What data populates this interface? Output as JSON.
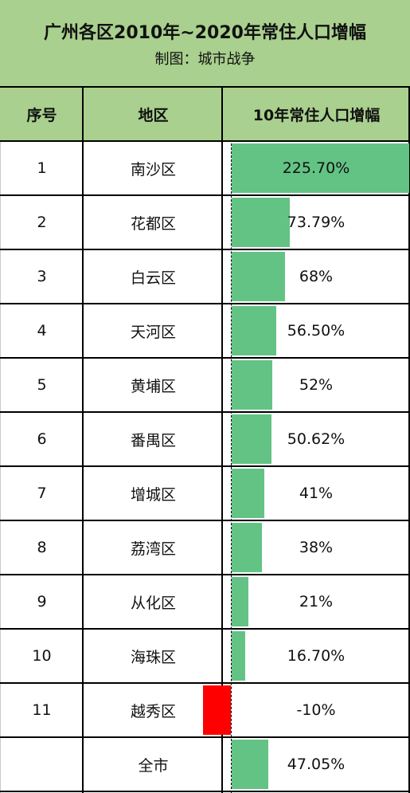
{
  "header": {
    "title": "广州各区2010年~2020年常住人口增幅",
    "subtitle": "制图：城市战争"
  },
  "columns": [
    "序号",
    "地区",
    "10年常住人口增幅"
  ],
  "colors": {
    "positive": "#63c384",
    "negative": "#ff0000",
    "header_bg": "#a9d08e"
  },
  "rows": [
    {
      "no": "1",
      "district": "南沙区",
      "label": "225.70%"
    },
    {
      "no": "2",
      "district": "花都区",
      "label": "73.79%"
    },
    {
      "no": "3",
      "district": "白云区",
      "label": "68%"
    },
    {
      "no": "4",
      "district": "天河区",
      "label": "56.50%"
    },
    {
      "no": "5",
      "district": "黄埔区",
      "label": "52%"
    },
    {
      "no": "6",
      "district": "番禺区",
      "label": "50.62%"
    },
    {
      "no": "7",
      "district": "增城区",
      "label": "41%"
    },
    {
      "no": "8",
      "district": "荔湾区",
      "label": "38%"
    },
    {
      "no": "9",
      "district": "从化区",
      "label": "21%"
    },
    {
      "no": "10",
      "district": "海珠区",
      "label": "16.70%"
    },
    {
      "no": "11",
      "district": "越秀区",
      "label": "-10%"
    },
    {
      "no": "",
      "district": "全市",
      "label": "47.05%"
    }
  ],
  "chart_data": {
    "type": "table",
    "title": "广州各区2010年~2020年常住人口增幅",
    "subtitle": "制图：城市战争",
    "columns": [
      "序号",
      "地区",
      "10年常住人口增幅"
    ],
    "categories": [
      "南沙区",
      "花都区",
      "白云区",
      "天河区",
      "黄埔区",
      "番禺区",
      "增城区",
      "荔湾区",
      "从化区",
      "海珠区",
      "越秀区",
      "全市"
    ],
    "values": [
      225.7,
      73.79,
      68,
      56.5,
      52,
      50.62,
      41,
      38,
      21,
      16.7,
      -10,
      47.05
    ],
    "unit": "%",
    "bar_range": [
      -10,
      225.7
    ]
  }
}
